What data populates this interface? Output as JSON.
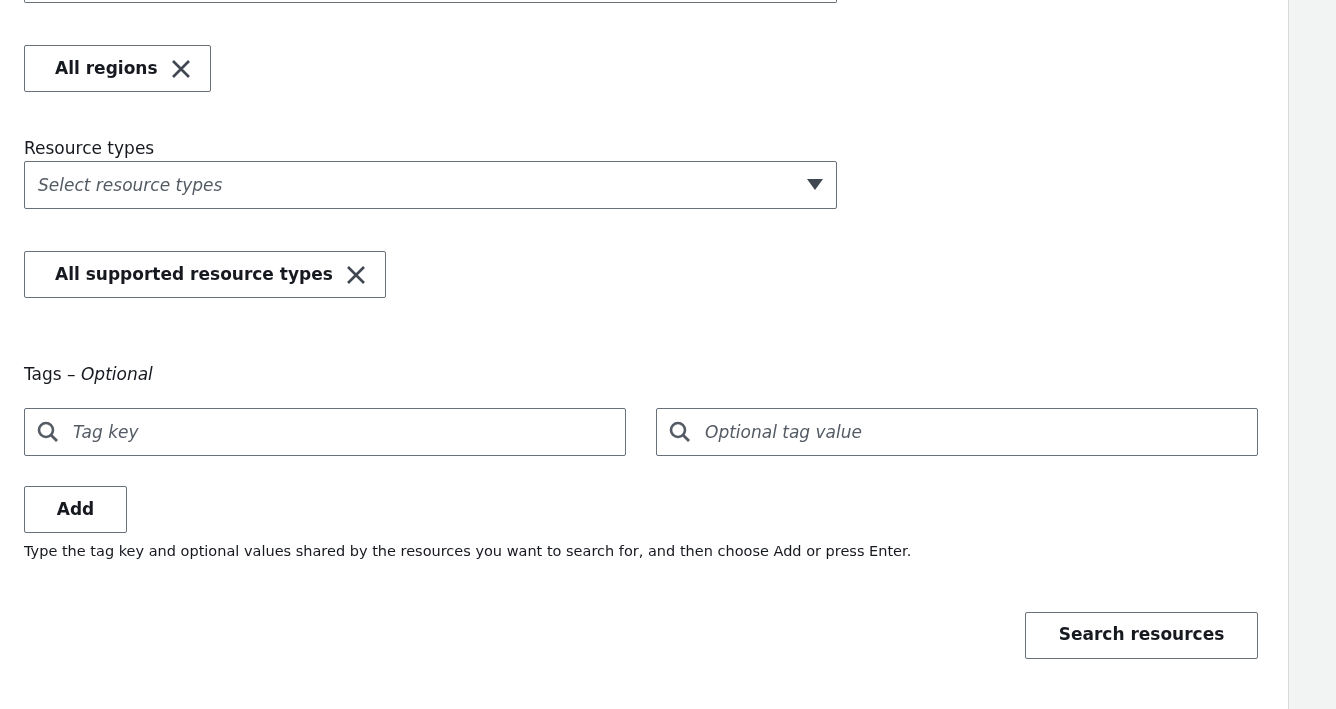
{
  "region_tokens": [
    {
      "label": "All regions"
    }
  ],
  "resource_types": {
    "label": "Resource types",
    "placeholder": "Select resource types"
  },
  "resource_type_tokens": [
    {
      "label": "All supported resource types"
    }
  ],
  "tags": {
    "label": "Tags – *Optional*",
    "key_field": {
      "placeholder": "Tag key"
    },
    "value_field": {
      "placeholder": "Optional tag value"
    },
    "add_button": "Add",
    "hint": "Type the tag key and optional values shared by the resources you want to search for, and then choose Add or press Enter."
  },
  "search_button": "Search resources"
}
